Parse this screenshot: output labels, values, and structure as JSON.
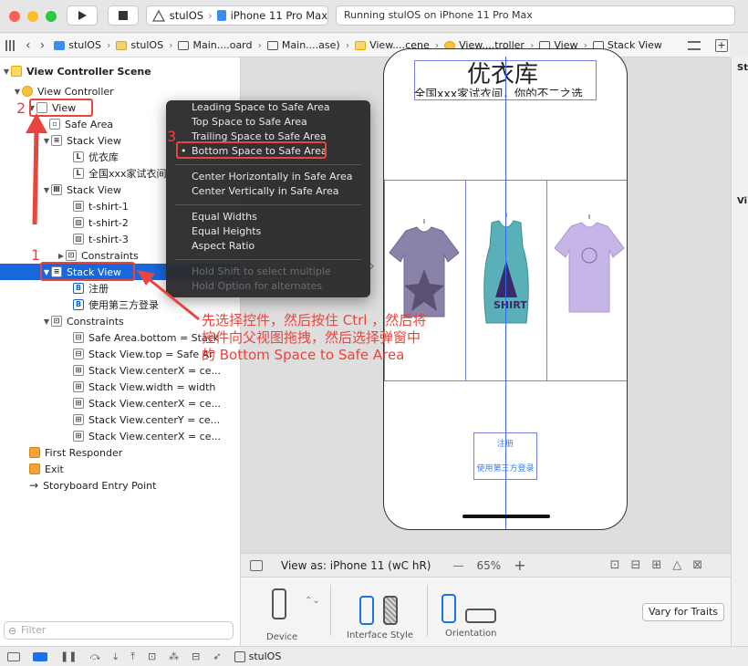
{
  "toolbar": {
    "scheme_target": "stulOS",
    "scheme_device": "iPhone 11 Pro Max",
    "status_text": "Running stulOS on iPhone 11 Pro Max"
  },
  "jumpbar": {
    "crumbs": [
      "stulOS",
      "stulOS",
      "Main....oard",
      "Main....ase)",
      "View....cene",
      "View....troller",
      "View",
      "Stack View"
    ]
  },
  "navigator": {
    "rows": [
      {
        "label": "View Controller Scene",
        "icon": "scene-icon"
      },
      {
        "label": "View Controller",
        "icon": "view-controller-icon"
      },
      {
        "label": "View",
        "icon": "view-icon"
      },
      {
        "label": "Safe Area",
        "icon": "safe-area-icon"
      },
      {
        "label": "Stack View",
        "icon": "stack-view-icon"
      },
      {
        "label": "优衣库",
        "icon": "label-icon"
      },
      {
        "label": "全国xxx家试衣间",
        "icon": "label-icon"
      },
      {
        "label": "Stack View",
        "icon": "stack-view-icon"
      },
      {
        "label": "t-shirt-1",
        "icon": "image-view-icon"
      },
      {
        "label": "t-shirt-2",
        "icon": "image-view-icon"
      },
      {
        "label": "t-shirt-3",
        "icon": "image-view-icon"
      },
      {
        "label": "Constraints",
        "icon": "constraints-icon"
      },
      {
        "label": "Stack View",
        "icon": "stack-view-icon"
      },
      {
        "label": "注册",
        "icon": "button-icon"
      },
      {
        "label": "使用第三方登录",
        "icon": "button-icon"
      },
      {
        "label": "Constraints",
        "icon": "constraints-icon"
      },
      {
        "label": "Safe Area.bottom = Stack",
        "icon": "constraint-icon"
      },
      {
        "label": "Stack View.top = Safe Ar",
        "icon": "constraint-icon"
      },
      {
        "label": "Stack View.centerX = ce...",
        "icon": "constraint-icon"
      },
      {
        "label": "Stack View.width = width",
        "icon": "constraint-icon"
      },
      {
        "label": "Stack View.centerX = ce...",
        "icon": "constraint-icon"
      },
      {
        "label": "Stack View.centerY = ce...",
        "icon": "constraint-icon"
      },
      {
        "label": "Stack View.centerX = ce...",
        "icon": "constraint-icon"
      },
      {
        "label": "First Responder",
        "icon": "first-responder-icon"
      },
      {
        "label": "Exit",
        "icon": "exit-icon"
      },
      {
        "label": "Storyboard Entry Point",
        "icon": "arrow-icon"
      }
    ],
    "filter_placeholder": "Filter"
  },
  "context_menu": {
    "items": [
      "Leading Space to Safe Area",
      "Top Space to Safe Area",
      "Trailing Space to Safe Area",
      "Bottom Space to Safe Area",
      "Center Horizontally in Safe Area",
      "Center Vertically in Safe Area",
      "Equal Widths",
      "Equal Heights",
      "Aspect Ratio",
      "Hold Shift to select multiple",
      "Hold Option for alternates"
    ],
    "bullet": "•"
  },
  "canvas": {
    "title_label": "优衣库",
    "subtitle_label": "全国xxx家试衣间，你的不二之选",
    "register_button": "注册",
    "third_party_button": "使用第三方登录"
  },
  "annotation": {
    "num1": "1",
    "num2": "2",
    "num3": "3",
    "text_line1": "先选择控件，然后按住 Ctrl ，然后将",
    "text_line2": "控件向父视图拖拽，然后选择弹窗中",
    "text_line3": "的 Bottom Space to Safe Area",
    "color": "#e8453c"
  },
  "canvas_bar": {
    "view_as": "View as: iPhone 11 (wC hR)",
    "minus": "—",
    "zoom": "65%",
    "plus": "+"
  },
  "device_bar": {
    "device_label": "Device",
    "interface_style_label": "Interface Style",
    "orientation_label": "Orientation",
    "vary_button": "Vary for Traits"
  },
  "bottom_bar": {
    "target": "stulOS"
  },
  "colors": {
    "selection": "#1867dc",
    "constraint_blue": "#3b69f0",
    "annotation_red": "#e8453c"
  }
}
